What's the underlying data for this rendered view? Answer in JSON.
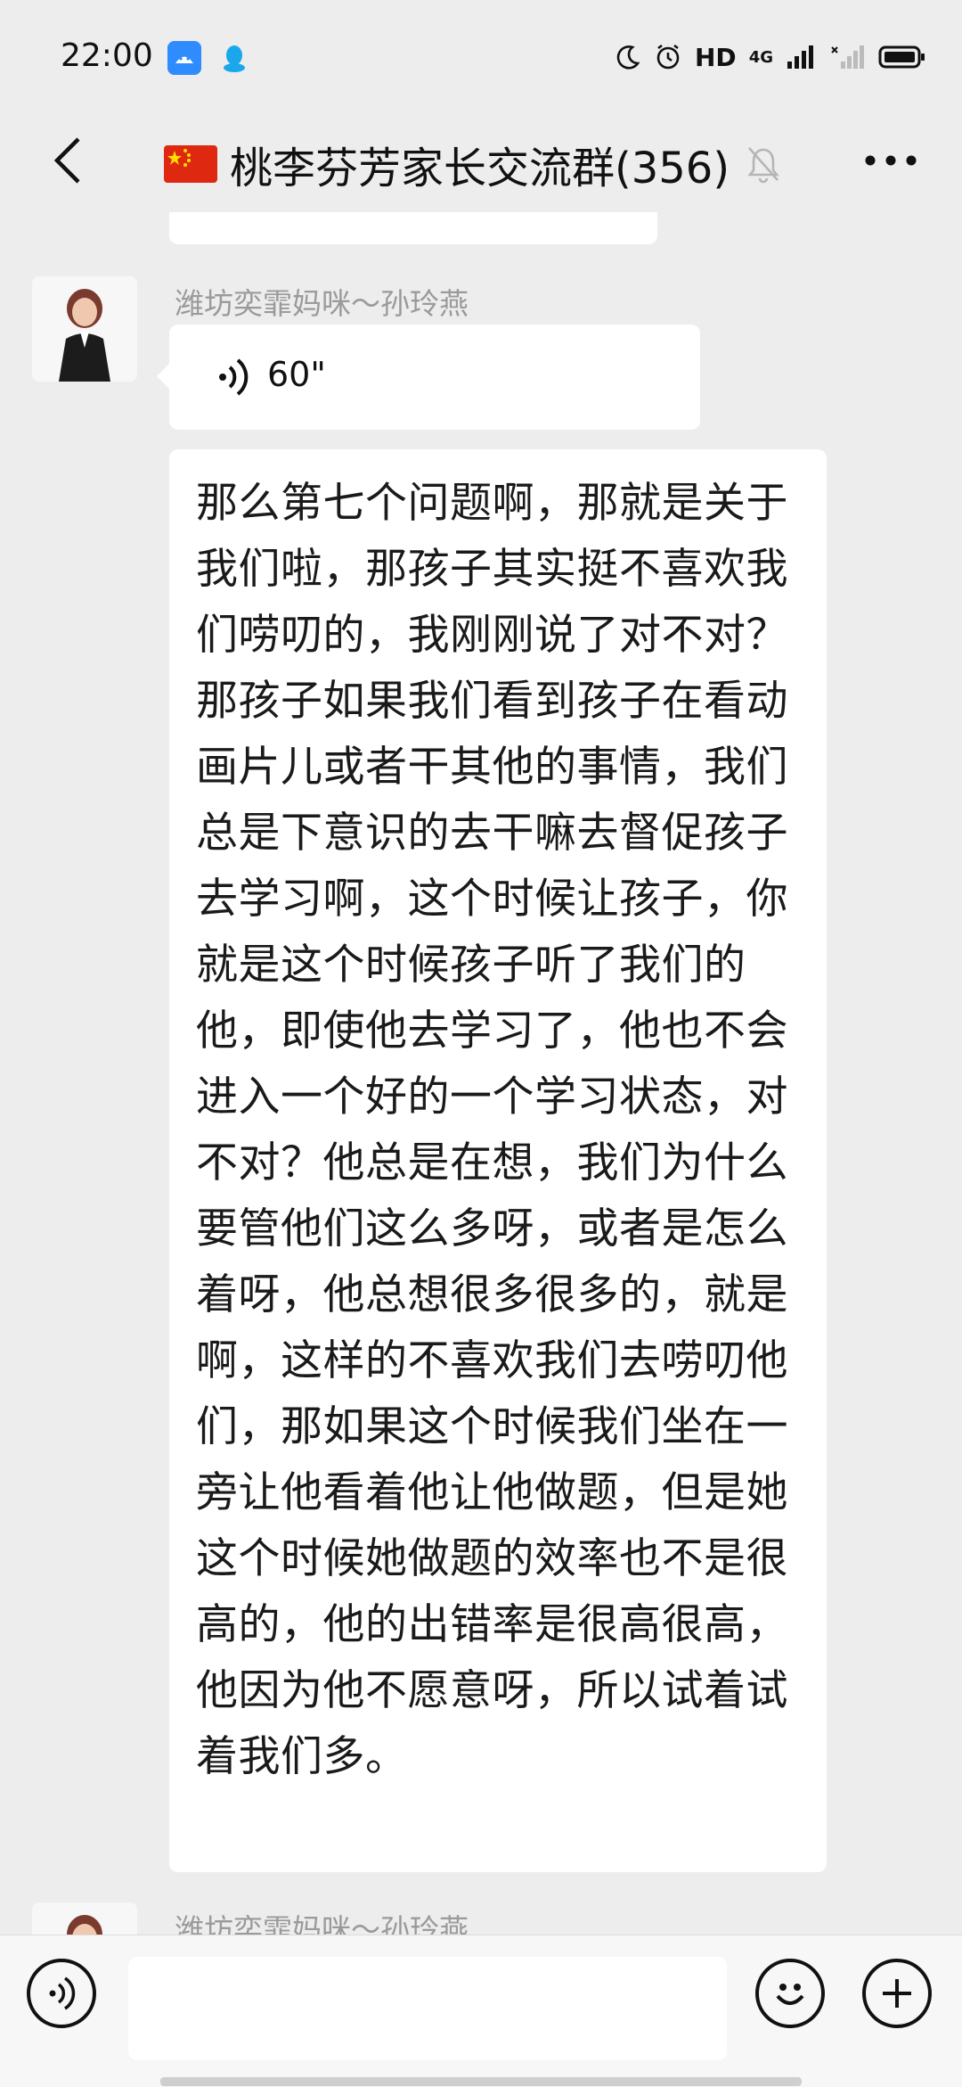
{
  "status_bar": {
    "time": "22:00",
    "network_label": "HD",
    "signal_label": "4G"
  },
  "header": {
    "title": "桃李芬芳家长交流群(356)"
  },
  "messages": [
    {
      "sender": "潍坊奕霏妈咪～孙玲燕",
      "voice_duration": "60\"",
      "text": "那么第七个问题啊，那就是关于我们啦，那孩子其实挺不喜欢我们唠叨的，我刚刚说了对不对？那孩子如果我们看到孩子在看动画片儿或者干其他的事情，我们总是下意识的去干嘛去督促孩子去学习啊，这个时候让孩子，你就是这个时候孩子听了我们的他，即使他去学习了，他也不会进入一个好的一个学习状态，对不对？他总是在想，我们为什么要管他们这么多呀，或者是怎么着呀，他总想很多很多的，就是啊，这样的不喜欢我们去唠叨他们，那如果这个时候我们坐在一旁让他看着他让他做题，但是她这个时候她做题的效率也不是很高的，他的出错率是很高很高，他因为他不愿意呀，所以试着试着我们多。"
    },
    {
      "sender": "潍坊奕霏妈咪～孙玲燕"
    }
  ],
  "input_bar": {
    "placeholder": ""
  }
}
